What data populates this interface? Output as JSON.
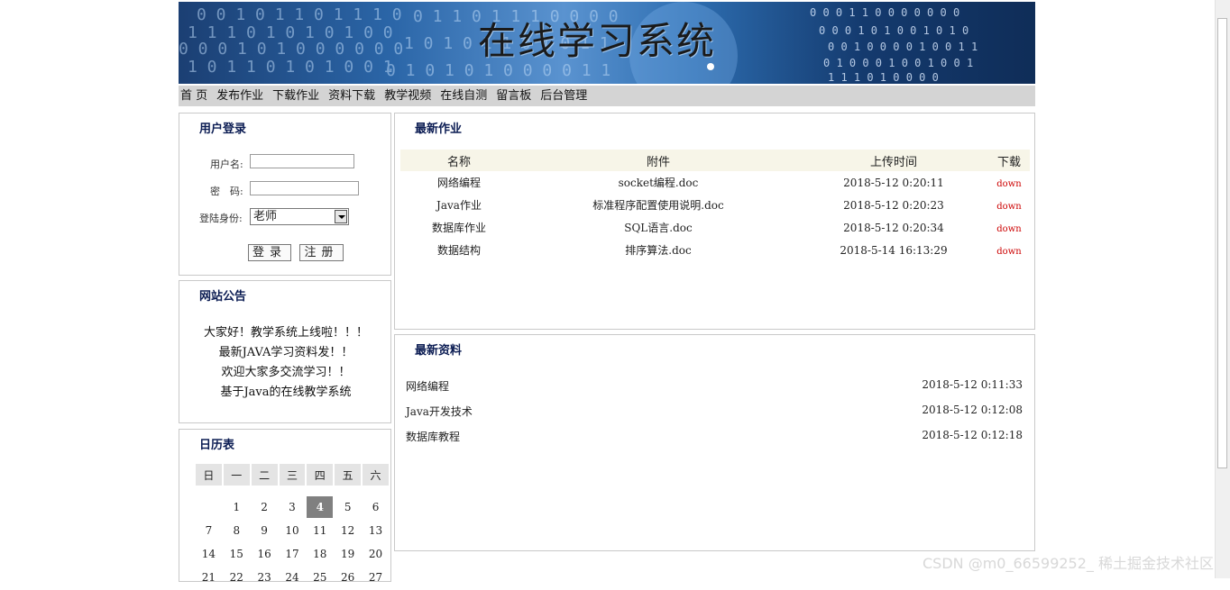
{
  "banner": {
    "title": "在线学习系统"
  },
  "nav": [
    "首 页",
    "发布作业",
    "下载作业",
    "资料下载",
    "教学视频",
    "在线自测",
    "留言板",
    "后台管理"
  ],
  "login": {
    "title": "用户登录",
    "username_label": "用户名:",
    "password_label": "密　码:",
    "role_label": "登陆身份:",
    "role_value": "老师",
    "login_button": "登录",
    "register_button": "注册"
  },
  "notices": {
    "title": "网站公告",
    "items": [
      "大家好！教学系统上线啦！！！",
      "最新JAVA学习资料发！！",
      "欢迎大家多交流学习！！",
      "基于Java的在线教学系统"
    ]
  },
  "calendar": {
    "title": "日历表",
    "weekdays": [
      "日",
      "一",
      "二",
      "三",
      "四",
      "五",
      "六"
    ],
    "rows": [
      [
        "",
        "1",
        "2",
        "3",
        "4",
        "5",
        "6"
      ],
      [
        "7",
        "8",
        "9",
        "10",
        "11",
        "12",
        "13"
      ],
      [
        "14",
        "15",
        "16",
        "17",
        "18",
        "19",
        "20"
      ],
      [
        "21",
        "22",
        "23",
        "24",
        "25",
        "26",
        "27"
      ]
    ],
    "today": "4"
  },
  "homework": {
    "title": "最新作业",
    "columns": [
      "名称",
      "附件",
      "上传时间",
      "下载"
    ],
    "rows": [
      {
        "name": "网络编程",
        "file": "socket编程.doc",
        "time": "2018-5-12 0:20:11",
        "dl": "down"
      },
      {
        "name": "Java作业",
        "file": "标准程序配置使用说明.doc",
        "time": "2018-5-12 0:20:23",
        "dl": "down"
      },
      {
        "name": "数据库作业",
        "file": "SQL语言.doc",
        "time": "2018-5-12 0:20:34",
        "dl": "down"
      },
      {
        "name": "数据结构",
        "file": "排序算法.doc",
        "time": "2018-5-14 16:13:29",
        "dl": "down"
      }
    ]
  },
  "resources": {
    "title": "最新资料",
    "items": [
      {
        "name": "网络编程",
        "time": "2018-5-12 0:11:33"
      },
      {
        "name": "Java开发技术",
        "time": "2018-5-12 0:12:08"
      },
      {
        "name": "数据库教程",
        "time": "2018-5-12 0:12:18"
      }
    ]
  },
  "watermark": "CSDN @m0_66599252_ 稀土掘金技术社区"
}
